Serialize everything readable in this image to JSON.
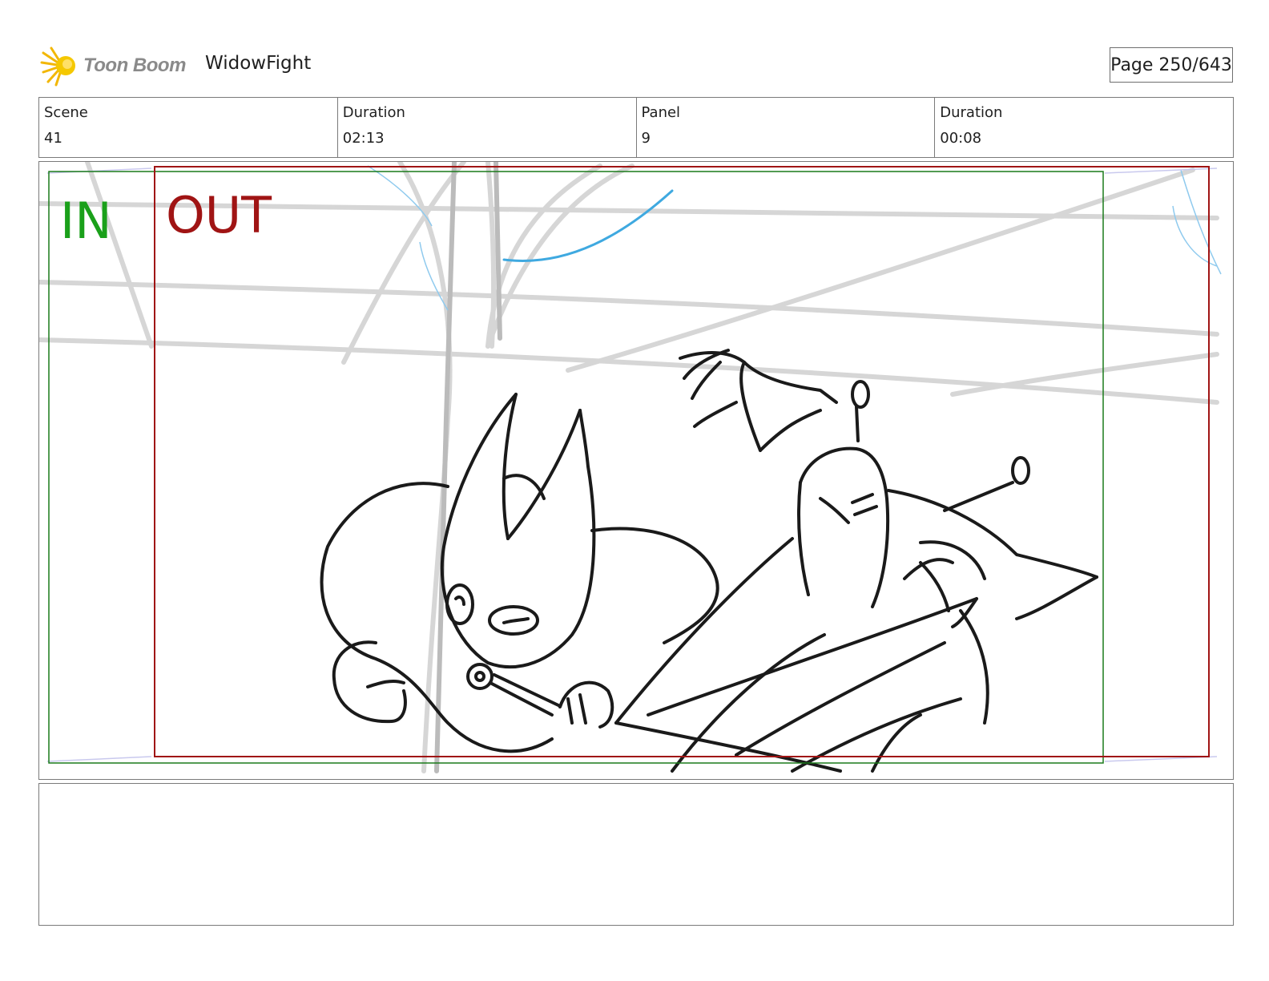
{
  "header": {
    "logo_text": "Toon Boom",
    "project_name": "WidowFight",
    "page_label": "Page 250/643"
  },
  "info": {
    "scene_label": "Scene",
    "scene_value": "41",
    "scene_duration_label": "Duration",
    "scene_duration_value": "02:13",
    "panel_label": "Panel",
    "panel_value": "9",
    "panel_duration_label": "Duration",
    "panel_duration_value": "00:08"
  },
  "panel": {
    "in_label": "IN",
    "out_label": "OUT",
    "in_color": "#1aa01a",
    "out_color": "#a01414"
  },
  "notes": {
    "text": ""
  }
}
